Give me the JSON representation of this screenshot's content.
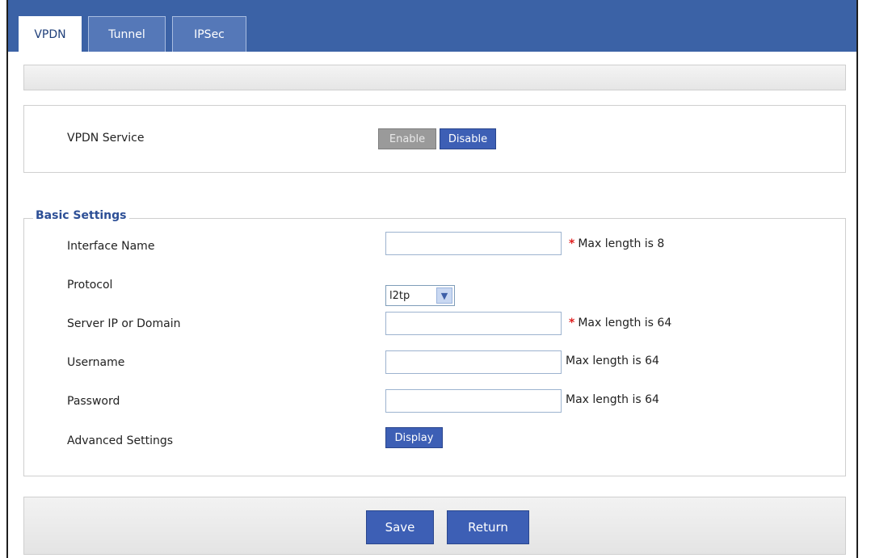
{
  "tabs": [
    {
      "label": "VPDN",
      "active": true
    },
    {
      "label": "Tunnel",
      "active": false
    },
    {
      "label": "IPSec",
      "active": false
    }
  ],
  "service": {
    "label": "VPDN Service",
    "enable_label": "Enable",
    "disable_label": "Disable"
  },
  "basic": {
    "legend": "Basic Settings",
    "interface_name": {
      "label": "Interface Name",
      "value": "",
      "required_mark": "*",
      "hint": "Max length is 8"
    },
    "protocol": {
      "label": "Protocol",
      "selected": "l2tp"
    },
    "server": {
      "label": "Server IP or Domain",
      "value": "",
      "required_mark": "*",
      "hint": "Max length is 64"
    },
    "username": {
      "label": "Username",
      "value": "",
      "hint": "Max length is 64"
    },
    "password": {
      "label": "Password",
      "value": "",
      "hint": "Max length is 64"
    },
    "advanced": {
      "label": "Advanced Settings",
      "button_label": "Display"
    }
  },
  "footer": {
    "save_label": "Save",
    "return_label": "Return"
  },
  "colors": {
    "tab_bar": "#3b62a6",
    "button_blue": "#3d5fb5",
    "legend": "#2d4f96",
    "required": "#e02020"
  }
}
